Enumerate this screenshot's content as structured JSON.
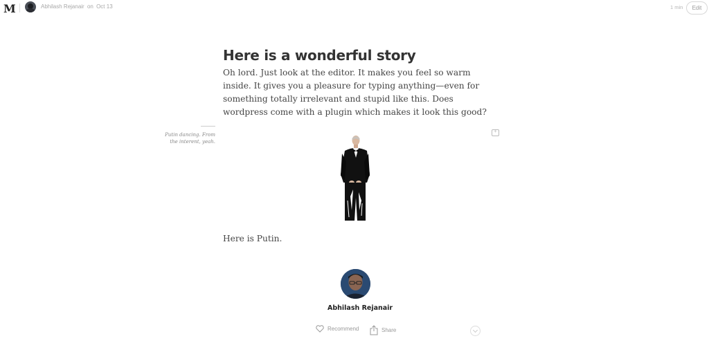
{
  "header": {
    "logo": "M",
    "author_name": "Abhilash Rejanair",
    "date_prefix": "on",
    "date": "Oct 13",
    "read_time": "1 min",
    "edit_label": "Edit"
  },
  "article": {
    "title": "Here is a wonderful story",
    "paragraph_1": "Oh lord. Just look at the editor. It makes you feel so warm inside. It gives you a pleasure for typing anything—even for something totally irrelevant and stupid like this. Does wordpress come with a plugin which makes it look this good?",
    "image_caption": "Putin dancing. From the interent, yeah.",
    "paragraph_2": "Here is Putin."
  },
  "author_card": {
    "name": "Abhilash Rejanair"
  },
  "footer": {
    "recommend_label": "Recommend",
    "share_label": "Share"
  }
}
